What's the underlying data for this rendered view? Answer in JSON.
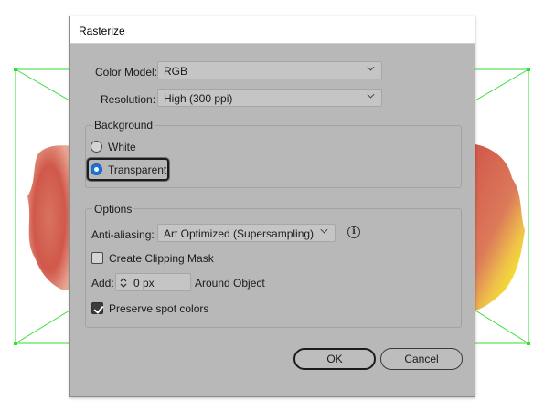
{
  "dialog": {
    "title": "Rasterize",
    "color_model": {
      "label": "Color Model:",
      "value": "RGB"
    },
    "resolution": {
      "label": "Resolution:",
      "value": "High (300 ppi)"
    },
    "background": {
      "title": "Background",
      "options": [
        {
          "label": "White",
          "selected": false
        },
        {
          "label": "Transparent",
          "selected": true
        }
      ]
    },
    "options": {
      "title": "Options",
      "anti_aliasing": {
        "label": "Anti-aliasing:",
        "value": "Art Optimized (Supersampling)"
      },
      "create_clipping_mask": {
        "label": "Create Clipping Mask",
        "checked": false
      },
      "add": {
        "label": "Add:",
        "value": "0 px",
        "suffix": "Around Object"
      },
      "preserve_spot_colors": {
        "label": "Preserve spot colors",
        "checked": true
      }
    },
    "buttons": {
      "ok": "OK",
      "cancel": "Cancel"
    }
  },
  "colors": {
    "dialog_bg": "#b8b8b8",
    "selection_green": "#33dd33",
    "radio_accent": "#1a73d9",
    "artwork_red": "#d4574a",
    "artwork_yellow": "#f2e21c"
  },
  "icons": [
    "info-icon",
    "chevron-down-icon",
    "stepper-icon",
    "checkmark-icon"
  ]
}
